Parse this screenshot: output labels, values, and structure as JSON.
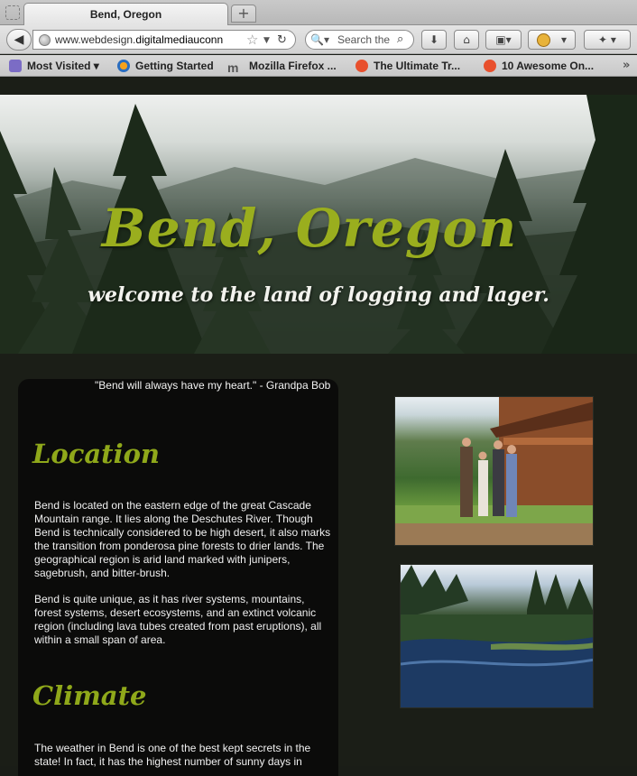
{
  "browser": {
    "tab_title": "Bend, Oregon",
    "new_tab_label": "+",
    "url_prefix": "www.webdesign.",
    "url_domain": "digitalmediauconn",
    "search_placeholder": "Search the",
    "bookmarks": [
      {
        "label": "Most Visited ▾"
      },
      {
        "label": "Getting Started"
      },
      {
        "label": "Mozilla Firefox ..."
      },
      {
        "label": "The Ultimate Tr..."
      },
      {
        "label": "10 Awesome On..."
      }
    ]
  },
  "hero": {
    "title": "Bend, Oregon",
    "subtitle": "welcome to the land of logging and lager."
  },
  "quote": "\"Bend will always have my heart.\" - Grandpa Bob",
  "sections": {
    "location_heading": "Location",
    "location_p1": "Bend is located on the eastern edge of the great Cascade Mountain range. It lies along the Deschutes River. Though Bend is technically considered to be high desert, it also marks the transition from ponderosa pine forests to drier lands. The geographical region is arid land marked with junipers, sagebrush, and bitter-brush.",
    "location_p2": "Bend is quite unique, as it has river systems, mountains, forest systems, desert ecosystems, and an extinct volcanic region (including lava tubes created from past eruptions), all within a small span of area.",
    "climate_heading": "Climate",
    "climate_p1": "The weather in Bend is one of the best kept secrets in the state! In fact, it has the highest number of sunny days in"
  },
  "colors": {
    "accent": "#8fa81a",
    "page_bg": "#1b1e17",
    "column_bg": "#0b0b0a"
  }
}
